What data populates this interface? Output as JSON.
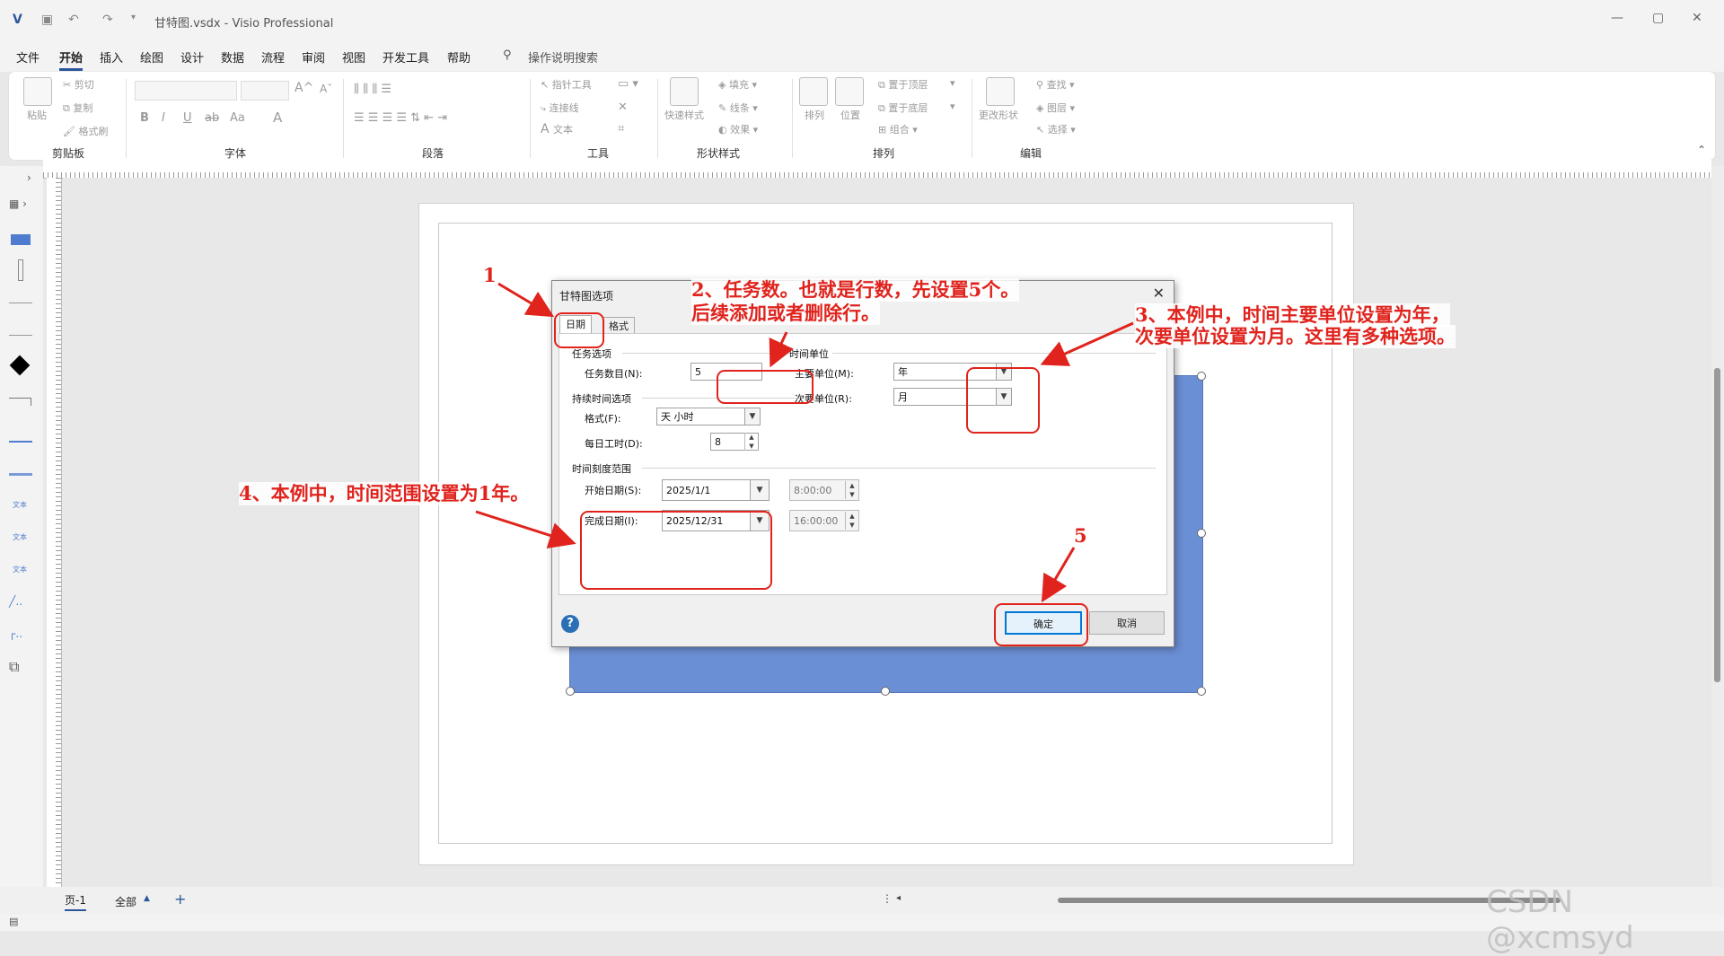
{
  "window": {
    "title": "甘特图.vsdx  -  Visio Professional"
  },
  "menu": {
    "items": [
      "文件",
      "开始",
      "插入",
      "绘图",
      "设计",
      "数据",
      "流程",
      "审阅",
      "视图",
      "开发工具",
      "帮助"
    ],
    "active": "开始",
    "search_label": "操作说明搜索"
  },
  "ribbon": {
    "groups": [
      "剪贴板",
      "字体",
      "段落",
      "工具",
      "形状样式",
      "排列",
      "编辑"
    ],
    "clipboard": {
      "paste": "粘贴",
      "cut": "剪切",
      "copy": "复制",
      "format_painter": "格式刷"
    },
    "tools": {
      "pointer": "指针工具",
      "connector": "连接线",
      "text": "文本"
    },
    "shape_style": {
      "quick_styles": "快速样式",
      "fill": "填充",
      "line": "线条",
      "effects": "效果"
    },
    "arrange": {
      "arrange": "排列",
      "position": "位置",
      "bring_to_front": "置于顶层",
      "send_to_back": "置于底层",
      "group": "组合"
    },
    "editing": {
      "change_shape": "更改形状",
      "find": "查找",
      "layers": "图层",
      "select": "选择"
    }
  },
  "status": {
    "page_tab": "页-1",
    "all_pages": "全部"
  },
  "dialog": {
    "title": "甘特图选项",
    "close_icon": "close-icon",
    "tabs": [
      "日期",
      "格式"
    ],
    "task_options": {
      "group_label": "任务选项",
      "task_count_label": "任务数目(N):",
      "task_count_value": "5"
    },
    "duration_options": {
      "group_label": "持续时间选项",
      "format_label": "格式(F):",
      "format_value": "天 小时",
      "hours_label": "每日工时(D):",
      "hours_value": "8"
    },
    "time_units": {
      "group_label": "时间单位",
      "major_label": "主要单位(M):",
      "major_value": "年",
      "minor_label": "次要单位(R):",
      "minor_value": "月"
    },
    "time_scale": {
      "group_label": "时间刻度范围",
      "start_label": "开始日期(S):",
      "start_date": "2025/1/1",
      "start_time": "8:00:00",
      "end_label": "完成日期(I):",
      "end_date": "2025/12/31",
      "end_time": "16:00:00"
    },
    "ok": "确定",
    "cancel": "取消"
  },
  "annotations": {
    "n1": "1",
    "n2_line1": "2、任务数。也就是行数，先设置5个。",
    "n2_line2": "后续添加或者删除行。",
    "n3_line1": "3、本例中，时间主要单位设置为年，",
    "n3_line2": "次要单位设置为月。这里有多种选项。",
    "n4": "4、本例中，时间范围设置为1年。",
    "n5": "5",
    "color": "#e0231d"
  },
  "watermark": "CSDN @xcmsyd"
}
